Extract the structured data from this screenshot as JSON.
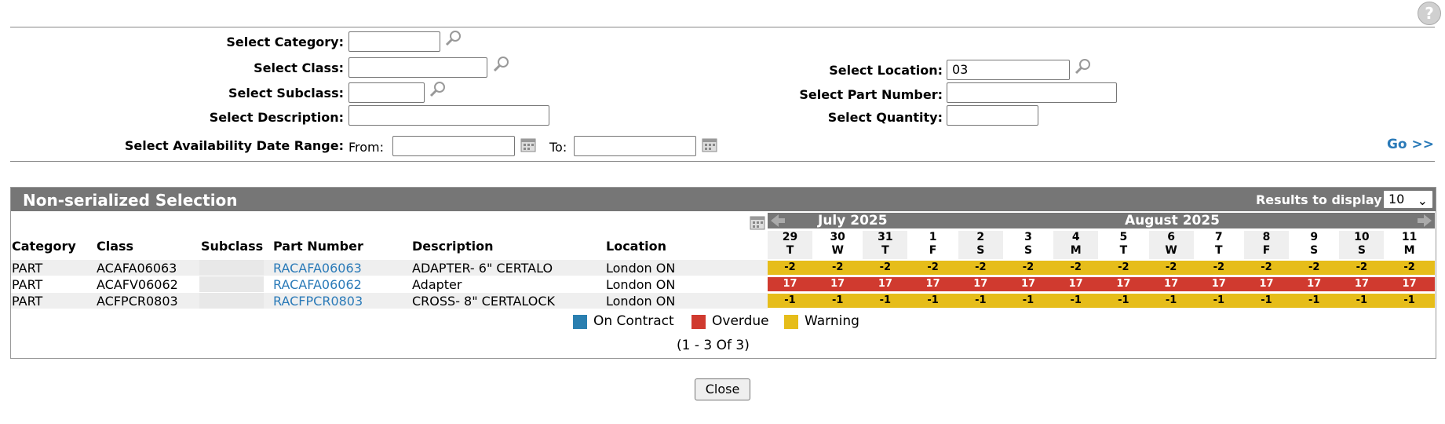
{
  "help": {
    "glyph": "?"
  },
  "filters": {
    "category_label": "Select Category:",
    "class_label": "Select Class:",
    "subclass_label": "Select Subclass:",
    "description_label": "Select Description:",
    "date_range_label": "Select Availability Date Range:",
    "from_label": "From:",
    "to_label": "To:",
    "location_label": "Select Location:",
    "location_value": "03",
    "part_number_label": "Select Part Number:",
    "quantity_label": "Select Quantity:",
    "go_label": "Go >>"
  },
  "panel": {
    "title": "Non-serialized Selection",
    "results_label": "Results to display:",
    "results_value": "10",
    "columns": [
      "Category",
      "Class",
      "Subclass",
      "Part Number",
      "Description",
      "Location"
    ],
    "rows": [
      {
        "category": "PART",
        "class": "ACAFA06063",
        "subclass": "",
        "part_number": "RACAFA06063",
        "description": "ADAPTER- 6\" CERTALO",
        "location": "London ON",
        "status": "warning",
        "values": [
          "-2",
          "-2",
          "-2",
          "-2",
          "-2",
          "-2",
          "-2",
          "-2",
          "-2",
          "-2",
          "-2",
          "-2",
          "-2",
          "-2"
        ]
      },
      {
        "category": "PART",
        "class": "ACAFV06062",
        "subclass": "",
        "part_number": "RACAFA06062",
        "description": "Adapter",
        "location": "London ON",
        "status": "overdue",
        "values": [
          "17",
          "17",
          "17",
          "17",
          "17",
          "17",
          "17",
          "17",
          "17",
          "17",
          "17",
          "17",
          "17",
          "17"
        ]
      },
      {
        "category": "PART",
        "class": "ACFPCR0803",
        "subclass": "",
        "part_number": "RACFPCR0803",
        "description": "CROSS- 8\" CERTALOCK",
        "location": "London ON",
        "status": "warning",
        "values": [
          "-1",
          "-1",
          "-1",
          "-1",
          "-1",
          "-1",
          "-1",
          "-1",
          "-1",
          "-1",
          "-1",
          "-1",
          "-1",
          "-1"
        ]
      }
    ],
    "months": [
      "July 2025",
      "August 2025"
    ],
    "days": [
      {
        "d": "29",
        "w": "T"
      },
      {
        "d": "30",
        "w": "W"
      },
      {
        "d": "31",
        "w": "T"
      },
      {
        "d": "1",
        "w": "F"
      },
      {
        "d": "2",
        "w": "S"
      },
      {
        "d": "3",
        "w": "S"
      },
      {
        "d": "4",
        "w": "M"
      },
      {
        "d": "5",
        "w": "T"
      },
      {
        "d": "6",
        "w": "W"
      },
      {
        "d": "7",
        "w": "T"
      },
      {
        "d": "8",
        "w": "F"
      },
      {
        "d": "9",
        "w": "S"
      },
      {
        "d": "10",
        "w": "S"
      },
      {
        "d": "11",
        "w": "M"
      }
    ],
    "legend": [
      {
        "label": "On Contract",
        "color": "#2a7fb0"
      },
      {
        "label": "Overdue",
        "color": "#d03a2f"
      },
      {
        "label": "Warning",
        "color": "#e6bd1a"
      }
    ],
    "pager": "(1 - 3 Of 3)"
  },
  "close_label": "Close"
}
